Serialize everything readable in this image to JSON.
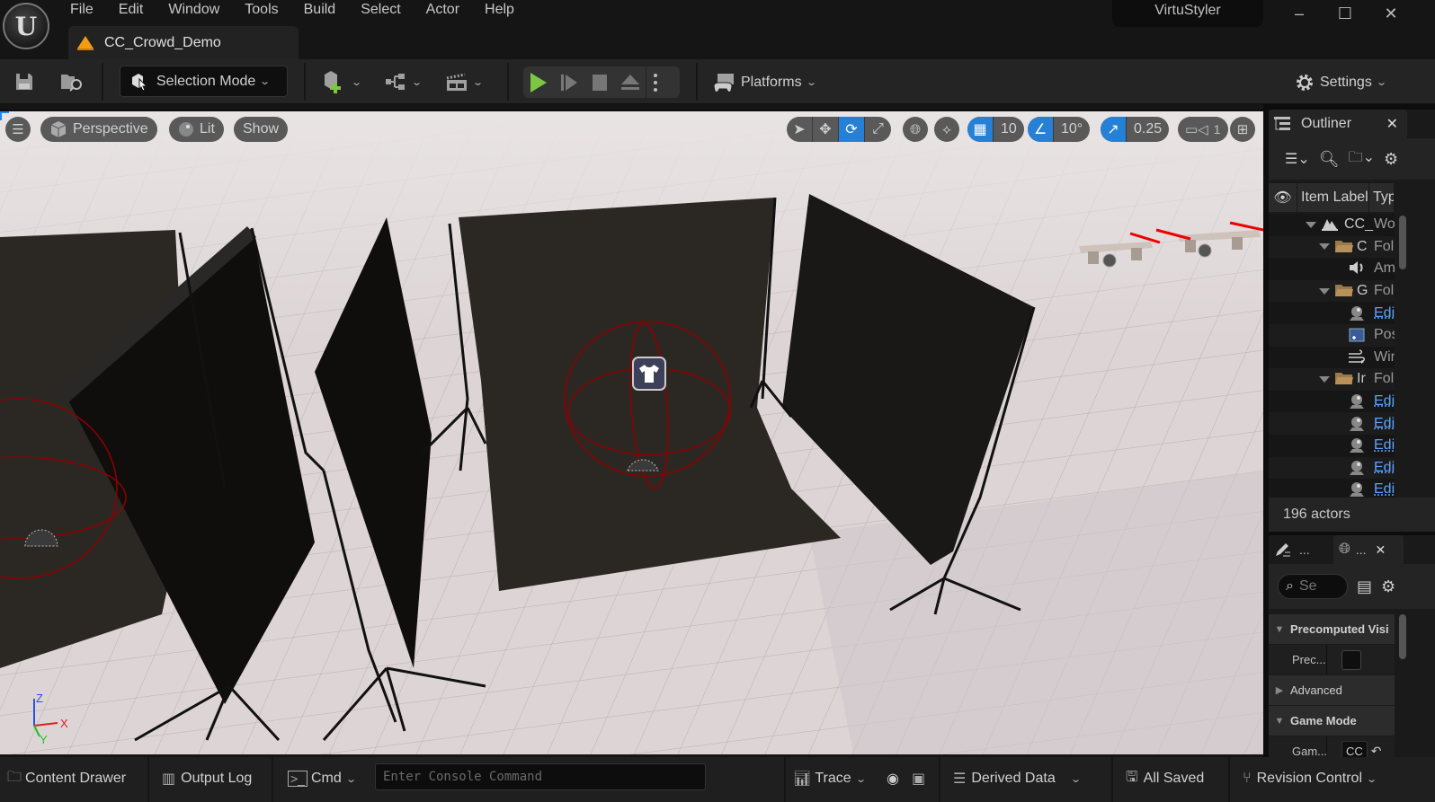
{
  "app": {
    "menu": [
      "File",
      "Edit",
      "Window",
      "Tools",
      "Build",
      "Select",
      "Actor",
      "Help"
    ],
    "document_tab": "CC_Crowd_Demo",
    "project_name": "VirtuStyler",
    "window_controls": {
      "minimize": "–",
      "maximize": "☐",
      "close": "✕"
    }
  },
  "toolbar": {
    "selection_mode_label": "Selection Mode",
    "platforms_label": "Platforms",
    "settings_label": "Settings",
    "play_color": "#7cc642"
  },
  "viewport": {
    "menu_label": "☰",
    "perspective_label": "Perspective",
    "lit_label": "Lit",
    "show_label": "Show",
    "transform_mode_active": "rotate",
    "grid_snap_value": "10",
    "rotation_snap_value": "10°",
    "scale_snap_value": "0.25",
    "camera_speed_value": "1",
    "accent_color": "#2680d6",
    "axis_labels": {
      "x": "X",
      "y": "Y",
      "z": "Z"
    }
  },
  "outliner": {
    "title": "Outliner",
    "close": "✕",
    "columns": {
      "label": "Item Label",
      "type": "Type"
    },
    "rows": [
      {
        "indent": 0,
        "expander": true,
        "icon": "level-icon",
        "name": "CC_",
        "type": "World",
        "link": false
      },
      {
        "indent": 1,
        "expander": true,
        "icon": "folder-icon",
        "name": "C",
        "type": "Folder",
        "link": false
      },
      {
        "indent": 2,
        "expander": false,
        "icon": "sound-icon",
        "name": "",
        "type": "Ambient",
        "link": false
      },
      {
        "indent": 1,
        "expander": true,
        "icon": "folder-icon",
        "name": "G",
        "type": "Folder",
        "link": false
      },
      {
        "indent": 2,
        "expander": false,
        "icon": "actor-icon",
        "name": "",
        "type": "Edit",
        "link": true
      },
      {
        "indent": 2,
        "expander": false,
        "icon": "volume-icon",
        "name": "",
        "type": "Post",
        "link": false
      },
      {
        "indent": 2,
        "expander": false,
        "icon": "wind-icon",
        "name": "",
        "type": "Wind",
        "link": false
      },
      {
        "indent": 1,
        "expander": true,
        "icon": "folder-icon",
        "name": "Ir",
        "type": "Folder",
        "link": false
      },
      {
        "indent": 2,
        "expander": false,
        "icon": "actor-icon",
        "name": "",
        "type": "Edit",
        "link": true
      },
      {
        "indent": 2,
        "expander": false,
        "icon": "actor-icon",
        "name": "",
        "type": "Edit",
        "link": true
      },
      {
        "indent": 2,
        "expander": false,
        "icon": "actor-icon",
        "name": "",
        "type": "Edit",
        "link": true
      },
      {
        "indent": 2,
        "expander": false,
        "icon": "actor-icon",
        "name": "",
        "type": "Edit",
        "link": true
      },
      {
        "indent": 2,
        "expander": false,
        "icon": "actor-icon",
        "name": "",
        "type": "Edit",
        "link": true
      }
    ],
    "actor_count": "196 actors"
  },
  "details": {
    "tab1_label": "...",
    "tab2_label": "...",
    "close": "✕",
    "search_placeholder": "Se",
    "rows": [
      {
        "kind": "cat",
        "expanded": true,
        "label": "Precomputed Visibility"
      },
      {
        "kind": "prop",
        "label": "Prec...",
        "value_type": "checkbox",
        "value": false
      },
      {
        "kind": "cat",
        "expanded": false,
        "label": "Advanced"
      },
      {
        "kind": "cat",
        "expanded": true,
        "label": "Game Mode"
      },
      {
        "kind": "prop",
        "label": "Gam...",
        "value_type": "text",
        "value": "CC"
      }
    ]
  },
  "statusbar": {
    "content_drawer": "Content Drawer",
    "output_log": "Output Log",
    "cmd": "Cmd",
    "console_placeholder": "Enter Console Command",
    "trace": "Trace",
    "derived_data": "Derived Data",
    "all_saved": "All Saved",
    "revision_control": "Revision Control"
  }
}
